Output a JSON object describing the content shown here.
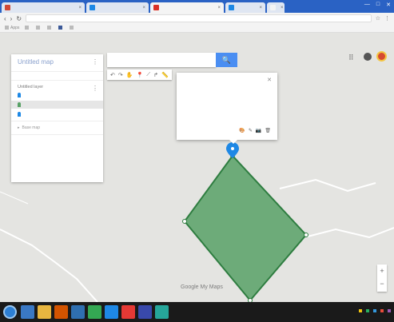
{
  "browser": {
    "tabs": [
      {
        "label": "",
        "fav": "#d14836",
        "w": 104
      },
      {
        "label": "",
        "fav": "#1e88e5",
        "w": 78
      },
      {
        "label": "",
        "fav": "#d93025",
        "w": 92,
        "active": true
      },
      {
        "label": "",
        "fav": "#1e88e5",
        "w": 50
      },
      {
        "label": "",
        "fav": "#f4f4f4",
        "w": 22
      }
    ],
    "url": "",
    "bookmarks": [
      "Apps",
      "",
      "",
      "",
      "",
      ""
    ]
  },
  "search_label": "🔍",
  "zoom_plus": "+",
  "zoom_minus": "−",
  "logo": "Google My Maps",
  "map_title": "Untitled map",
  "map_title_sub": "",
  "layer": "Untitled layer",
  "panel_item_one": "",
  "panel_item_two": "",
  "panel_item_three": "",
  "base_map": "Base map",
  "popup_title": "",
  "popup_text": "",
  "popup_links": "",
  "place_label": "",
  "copyright": "",
  "clock": {
    "time": "",
    "date": ""
  }
}
